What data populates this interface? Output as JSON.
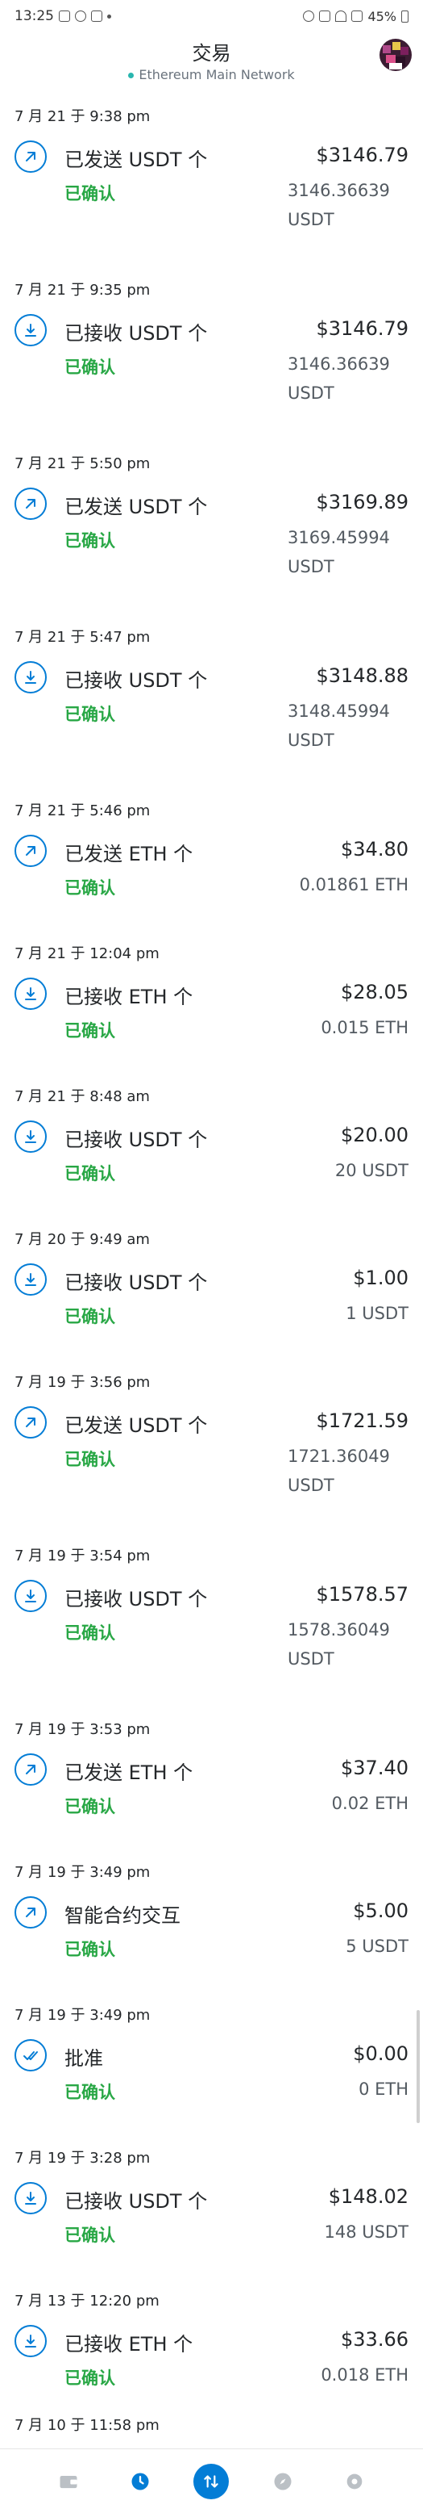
{
  "status_bar": {
    "time": "13:25",
    "battery": "45%"
  },
  "header": {
    "title": "交易",
    "network": "Ethereum Main Network"
  },
  "transactions": [
    {
      "date": "7 月 21 于 9:38 pm",
      "type": "send",
      "title": "已发送 USDT 个",
      "status": "已确认",
      "fiat": "$3146.79",
      "amount": "3146.36639 USDT",
      "wrap": true
    },
    {
      "date": "7 月 21 于 9:35 pm",
      "type": "receive",
      "title": "已接收 USDT 个",
      "status": "已确认",
      "fiat": "$3146.79",
      "amount": "3146.36639 USDT",
      "wrap": true
    },
    {
      "date": "7 月 21 于 5:50 pm",
      "type": "send",
      "title": "已发送 USDT 个",
      "status": "已确认",
      "fiat": "$3169.89",
      "amount": "3169.45994 USDT",
      "wrap": true
    },
    {
      "date": "7 月 21 于 5:47 pm",
      "type": "receive",
      "title": "已接收 USDT 个",
      "status": "已确认",
      "fiat": "$3148.88",
      "amount": "3148.45994 USDT",
      "wrap": true
    },
    {
      "date": "7 月 21 于 5:46 pm",
      "type": "send",
      "title": "已发送 ETH 个",
      "status": "已确认",
      "fiat": "$34.80",
      "amount": "0.01861 ETH",
      "wrap": false
    },
    {
      "date": "7 月 21 于 12:04 pm",
      "type": "receive",
      "title": "已接收 ETH 个",
      "status": "已确认",
      "fiat": "$28.05",
      "amount": "0.015 ETH",
      "wrap": false
    },
    {
      "date": "7 月 21 于 8:48 am",
      "type": "receive",
      "title": "已接收 USDT 个",
      "status": "已确认",
      "fiat": "$20.00",
      "amount": "20 USDT",
      "wrap": false
    },
    {
      "date": "7 月 20 于 9:49 am",
      "type": "receive",
      "title": "已接收 USDT 个",
      "status": "已确认",
      "fiat": "$1.00",
      "amount": "1 USDT",
      "wrap": false
    },
    {
      "date": "7 月 19 于 3:56 pm",
      "type": "send",
      "title": "已发送 USDT 个",
      "status": "已确认",
      "fiat": "$1721.59",
      "amount": "1721.36049 USDT",
      "wrap": true
    },
    {
      "date": "7 月 19 于 3:54 pm",
      "type": "receive",
      "title": "已接收 USDT 个",
      "status": "已确认",
      "fiat": "$1578.57",
      "amount": "1578.36049 USDT",
      "wrap": true
    },
    {
      "date": "7 月 19 于 3:53 pm",
      "type": "send",
      "title": "已发送 ETH 个",
      "status": "已确认",
      "fiat": "$37.40",
      "amount": "0.02 ETH",
      "wrap": false
    },
    {
      "date": "7 月 19 于 3:49 pm",
      "type": "send",
      "title": "智能合约交互",
      "status": "已确认",
      "fiat": "$5.00",
      "amount": "5 USDT",
      "wrap": false
    },
    {
      "date": "7 月 19 于 3:49 pm",
      "type": "approve",
      "title": "批准",
      "status": "已确认",
      "fiat": "$0.00",
      "amount": "0 ETH",
      "wrap": false
    },
    {
      "date": "7 月 19 于 3:28 pm",
      "type": "receive",
      "title": "已接收 USDT 个",
      "status": "已确认",
      "fiat": "$148.02",
      "amount": "148 USDT",
      "wrap": false
    },
    {
      "date": "7 月 13 于 12:20 pm",
      "type": "receive",
      "title": "已接收 ETH 个",
      "status": "已确认",
      "fiat": "$33.66",
      "amount": "0.018 ETH",
      "wrap": false
    }
  ],
  "tail_date": "7 月 10 于 11:58 pm",
  "colors": {
    "accent": "#037dd6",
    "success": "#28a745",
    "network_dot": "#29b6af"
  },
  "nav": [
    "wallet-icon",
    "clock-icon",
    "swap-icon",
    "compass-icon",
    "gear-icon"
  ]
}
